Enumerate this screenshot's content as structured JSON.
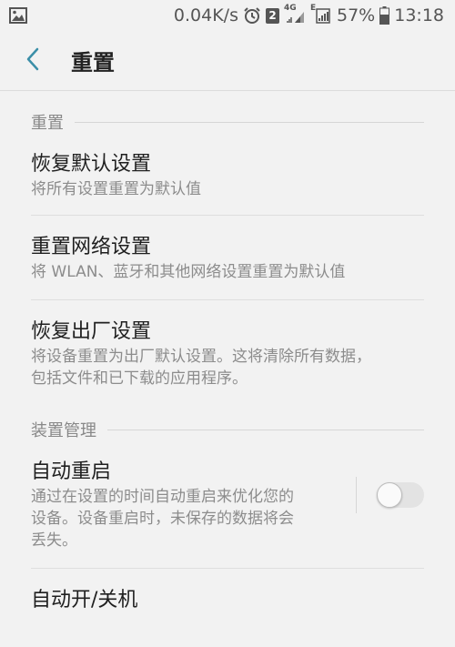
{
  "status_bar": {
    "speed": "0.04K/s",
    "notification_count": "2",
    "net_4g": "4G",
    "net_e": "E",
    "battery": "57%",
    "time": "13:18"
  },
  "header": {
    "title": "重置"
  },
  "sections": [
    {
      "header": "重置",
      "items": [
        {
          "title": "恢复默认设置",
          "subtitle": "将所有设置重置为默认值"
        },
        {
          "title": "重置网络设置",
          "subtitle": "将 WLAN、蓝牙和其他网络设置重置为默认值"
        },
        {
          "title": "恢复出厂设置",
          "subtitle_line1": "将设备重置为出厂默认设置。这将清除所有数据，",
          "subtitle_line2": "包括文件和已下载的应用程序。"
        }
      ]
    },
    {
      "header": "装置管理",
      "auto_restart": {
        "title": "自动重启",
        "subtitle_line1": "通过在设置的时间自动重启来优化您的",
        "subtitle_line2": "设备。设备重启时，未保存的数据将会",
        "subtitle_line3": "丢失。",
        "enabled": false
      },
      "next_item_title": "自动开/关机"
    }
  ],
  "colors": {
    "accent": "#3b8fa8",
    "background": "#f2f2f2"
  }
}
